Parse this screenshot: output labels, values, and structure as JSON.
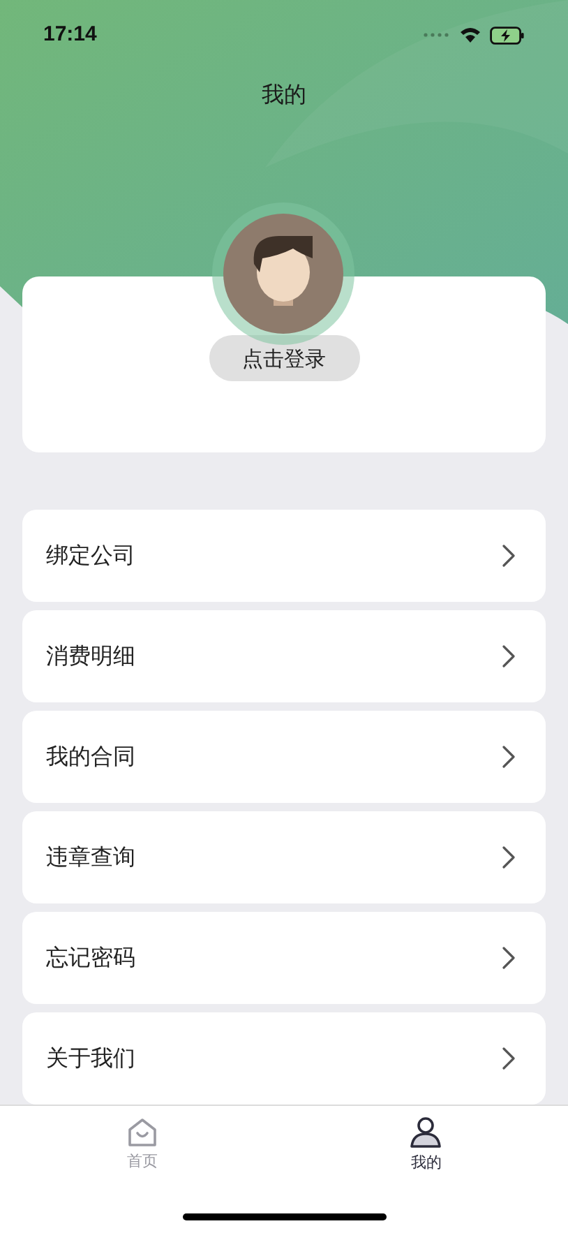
{
  "status_bar": {
    "time": "17:14"
  },
  "header": {
    "title": "我的"
  },
  "profile": {
    "login_button": "点击登录"
  },
  "menu": [
    {
      "label": "绑定公司"
    },
    {
      "label": "消费明细"
    },
    {
      "label": "我的合同"
    },
    {
      "label": "违章查询"
    },
    {
      "label": "忘记密码"
    },
    {
      "label": "关于我们"
    }
  ],
  "tab_bar": [
    {
      "label": "首页",
      "kind": "home",
      "selected": false
    },
    {
      "label": "我的",
      "kind": "profile",
      "selected": true
    }
  ]
}
